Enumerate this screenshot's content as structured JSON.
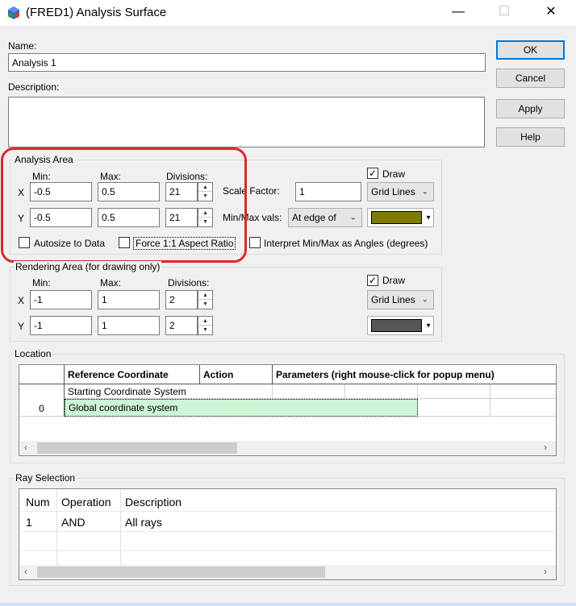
{
  "window": {
    "title": "(FRED1) Analysis Surface",
    "minimize_glyph": "—",
    "maximize_glyph": "☐",
    "close_glyph": "✕",
    "app_icon": "fred-app-icon"
  },
  "name_field": {
    "label": "Name:",
    "value": "Analysis 1"
  },
  "description_field": {
    "label": "Description:",
    "value": ""
  },
  "buttons": {
    "ok": "OK",
    "cancel": "Cancel",
    "apply": "Apply",
    "help": "Help"
  },
  "analysis_area": {
    "title": "Analysis Area",
    "min_label": "Min:",
    "max_label": "Max:",
    "divisions_label": "Divisions:",
    "x_label": "X",
    "y_label": "Y",
    "x_min": "-0.5",
    "x_max": "0.5",
    "x_div": "21",
    "y_min": "-0.5",
    "y_max": "0.5",
    "y_div": "21",
    "scale_factor_label": "Scale Factor:",
    "scale_factor": "1",
    "minmax_label": "Min/Max vals:",
    "minmax_value": "At edge of",
    "draw_label": "Draw",
    "draw_checked": true,
    "draw_mode": "Grid Lines",
    "draw_color": "#7f7a00",
    "autosize_label": "Autosize to Data",
    "force_aspect_label": "Force 1:1 Aspect Ratio",
    "interpret_label": "Interpret Min/Max as Angles (degrees)"
  },
  "rendering_area": {
    "title": "Rendering Area (for drawing only)",
    "min_label": "Min:",
    "max_label": "Max:",
    "divisions_label": "Divisions:",
    "x_label": "X",
    "y_label": "Y",
    "x_min": "-1",
    "x_max": "1",
    "x_div": "2",
    "y_min": "-1",
    "y_max": "1",
    "y_div": "2",
    "draw_label": "Draw",
    "draw_checked": true,
    "draw_mode": "Grid Lines",
    "draw_color": "#555555"
  },
  "location": {
    "title": "Location",
    "columns": [
      "Reference Coordinate",
      "Action",
      "Parameters (right mouse-click for popup menu)"
    ],
    "row_header": "0",
    "row_title": "Starting Coordinate System",
    "row_value": "Global coordinate system"
  },
  "ray_selection": {
    "title": "Ray Selection",
    "columns": [
      "Num",
      "Operation",
      "Description"
    ],
    "rows": [
      {
        "num": "1",
        "operation": "AND",
        "description": "All rays"
      }
    ]
  },
  "scroll": {
    "left": "‹",
    "right": "›"
  },
  "colors": {
    "accent": "#0078d7",
    "highlight": "#e0262e",
    "selected_cell": "#ccf5d6"
  }
}
